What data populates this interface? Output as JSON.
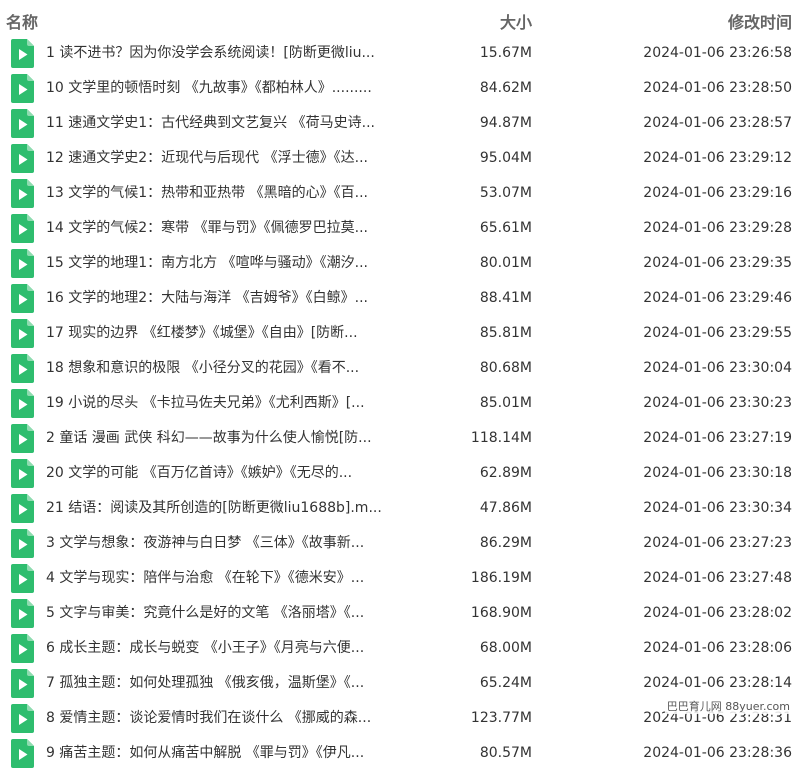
{
  "colors": {
    "icon_green": "#2ebd6e",
    "icon_fold": "#8fdcb0",
    "text": "#333333",
    "header_text": "#666666"
  },
  "header": {
    "name": "名称",
    "size": "大小",
    "modified": "修改时间"
  },
  "files": [
    {
      "name": "1 读不进书？因为你没学会系统阅读！[防断更微liu...",
      "size": "15.67M",
      "modified": "2024-01-06 23:26:58",
      "icon": "video-file-icon"
    },
    {
      "name": "10 文学里的顿悟时刻 《九故事》《都柏林人》.........",
      "size": "84.62M",
      "modified": "2024-01-06 23:28:50",
      "icon": "video-file-icon"
    },
    {
      "name": "11 速通文学史1：古代经典到文艺复兴 《荷马史诗...",
      "size": "94.87M",
      "modified": "2024-01-06 23:28:57",
      "icon": "video-file-icon"
    },
    {
      "name": "12 速通文学史2：近现代与后现代 《浮士德》《达...",
      "size": "95.04M",
      "modified": "2024-01-06 23:29:12",
      "icon": "video-file-icon"
    },
    {
      "name": "13 文学的气候1：热带和亚热带 《黑暗的心》《百...",
      "size": "53.07M",
      "modified": "2024-01-06 23:29:16",
      "icon": "video-file-icon"
    },
    {
      "name": "14 文学的气候2：寒带 《罪与罚》《佩德罗巴拉莫...",
      "size": "65.61M",
      "modified": "2024-01-06 23:29:28",
      "icon": "video-file-icon"
    },
    {
      "name": "15 文学的地理1：南方北方 《喧哗与骚动》《潮汐...",
      "size": "80.01M",
      "modified": "2024-01-06 23:29:35",
      "icon": "video-file-icon"
    },
    {
      "name": "16 文学的地理2：大陆与海洋 《吉姆爷》《白鲸》...",
      "size": "88.41M",
      "modified": "2024-01-06 23:29:46",
      "icon": "video-file-icon"
    },
    {
      "name": "17 现实的边界 《红楼梦》《城堡》《自由》[防断...",
      "size": "85.81M",
      "modified": "2024-01-06 23:29:55",
      "icon": "video-file-icon"
    },
    {
      "name": "18 想象和意识的极限 《小径分叉的花园》《看不...",
      "size": "80.68M",
      "modified": "2024-01-06 23:30:04",
      "icon": "video-file-icon"
    },
    {
      "name": "19 小说的尽头 《卡拉马佐夫兄弟》《尤利西斯》[...",
      "size": "85.01M",
      "modified": "2024-01-06 23:30:23",
      "icon": "video-file-icon"
    },
    {
      "name": "2 童话 漫画 武侠 科幻——故事为什么使人愉悦[防...",
      "size": "118.14M",
      "modified": "2024-01-06 23:27:19",
      "icon": "video-file-icon"
    },
    {
      "name": "20 文学的可能 《百万亿首诗》《嫉妒》《无尽的...",
      "size": "62.89M",
      "modified": "2024-01-06 23:30:18",
      "icon": "video-file-icon"
    },
    {
      "name": "21 结语：阅读及其所创造的[防断更微liu1688b].m...",
      "size": "47.86M",
      "modified": "2024-01-06 23:30:34",
      "icon": "video-file-icon"
    },
    {
      "name": "3 文学与想象：夜游神与白日梦 《三体》《故事新...",
      "size": "86.29M",
      "modified": "2024-01-06 23:27:23",
      "icon": "video-file-icon"
    },
    {
      "name": "4 文学与现实：陪伴与治愈 《在轮下》《德米安》...",
      "size": "186.19M",
      "modified": "2024-01-06 23:27:48",
      "icon": "video-file-icon"
    },
    {
      "name": "5 文字与审美：究竟什么是好的文笔 《洛丽塔》《...",
      "size": "168.90M",
      "modified": "2024-01-06 23:28:02",
      "icon": "video-file-icon"
    },
    {
      "name": "6 成长主题：成长与蜕变 《小王子》《月亮与六便...",
      "size": "68.00M",
      "modified": "2024-01-06 23:28:06",
      "icon": "video-file-icon"
    },
    {
      "name": "7 孤独主题：如何处理孤独 《俄亥俄，温斯堡》《...",
      "size": "65.24M",
      "modified": "2024-01-06 23:28:14",
      "icon": "video-file-icon"
    },
    {
      "name": "8 爱情主题：谈论爱情时我们在谈什么 《挪威的森...",
      "size": "123.77M",
      "modified": "2024-01-06 23:28:31",
      "icon": "video-file-icon"
    },
    {
      "name": "9 痛苦主题：如何从痛苦中解脱 《罪与罚》《伊凡...",
      "size": "80.57M",
      "modified": "2024-01-06 23:28:36",
      "icon": "video-file-icon"
    }
  ],
  "watermark": "巴巴育儿网 88yuer.com"
}
